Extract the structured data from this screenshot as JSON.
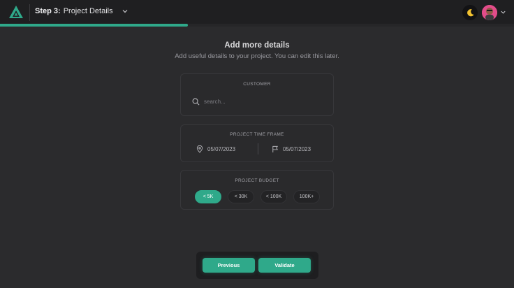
{
  "colors": {
    "accent": "#2fa98a",
    "background": "#2b2b2d",
    "topbar": "#1f1f21"
  },
  "header": {
    "logo_icon": "triangle-logo-icon",
    "step_number": "Step 3:",
    "step_title": "Project Details",
    "progress": 0.366,
    "theme_icon": "moon-icon"
  },
  "intro": {
    "title": "Add more details",
    "subtitle": "Add useful details to your project. You can edit this later."
  },
  "customer": {
    "title": "CUSTOMER",
    "search_placeholder": "search..."
  },
  "timeframe": {
    "title": "PROJECT TIME FRAME",
    "start_icon": "location-pin-icon",
    "start_date": "05/07/2023",
    "end_icon": "flag-icon",
    "end_date": "05/07/2023"
  },
  "budget": {
    "title": "PROJECT BUDGET",
    "options": [
      "< 5K",
      "< 30K",
      "< 100K",
      "100K+"
    ],
    "selected": "< 5K"
  },
  "footer": {
    "previous_label": "Previous",
    "validate_label": "Validate"
  }
}
